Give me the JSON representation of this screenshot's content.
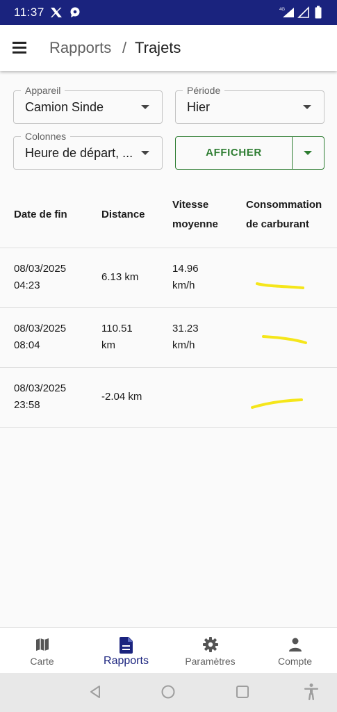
{
  "status_bar": {
    "time": "11:37",
    "icons": [
      "x-logo-icon",
      "chat-bubble-icon",
      "4g-signal-icon",
      "signal-icon",
      "battery-icon"
    ]
  },
  "app_bar": {
    "breadcrumb_parent": "Rapports",
    "breadcrumb_separator": "/",
    "breadcrumb_current": "Trajets"
  },
  "form": {
    "device": {
      "label": "Appareil",
      "value": "Camion Sinde"
    },
    "period": {
      "label": "Période",
      "value": "Hier"
    },
    "columns": {
      "label": "Colonnes",
      "value": "Heure de départ, ..."
    },
    "show_button": "AFFICHER"
  },
  "table": {
    "headers": {
      "end_date": "Date de fin",
      "distance": "Distance",
      "avg_speed_1": "Vitesse",
      "avg_speed_2": "moyenne",
      "fuel_1": "Consommation",
      "fuel_2": "de carburant"
    },
    "rows": [
      {
        "date": "08/03/2025",
        "time": "04:23",
        "distance": "6.13 km",
        "distance_2": "",
        "speed": "14.96",
        "speed_unit": "km/h"
      },
      {
        "date": "08/03/2025",
        "time": "08:04",
        "distance": "110.51",
        "distance_2": "km",
        "speed": "31.23",
        "speed_unit": "km/h"
      },
      {
        "date": "08/03/2025",
        "time": "23:58",
        "distance": "-2.04 km",
        "distance_2": "",
        "speed": "",
        "speed_unit": ""
      }
    ]
  },
  "bottom_nav": [
    {
      "label": "Carte",
      "icon": "map-icon",
      "active": false
    },
    {
      "label": "Rapports",
      "icon": "document-icon",
      "active": true
    },
    {
      "label": "Paramètres",
      "icon": "gear-icon",
      "active": false
    },
    {
      "label": "Compte",
      "icon": "person-icon",
      "active": false
    }
  ],
  "colors": {
    "primary": "#1a237e",
    "accent_green": "#2e7d32",
    "highlight": "#f5e61a"
  }
}
